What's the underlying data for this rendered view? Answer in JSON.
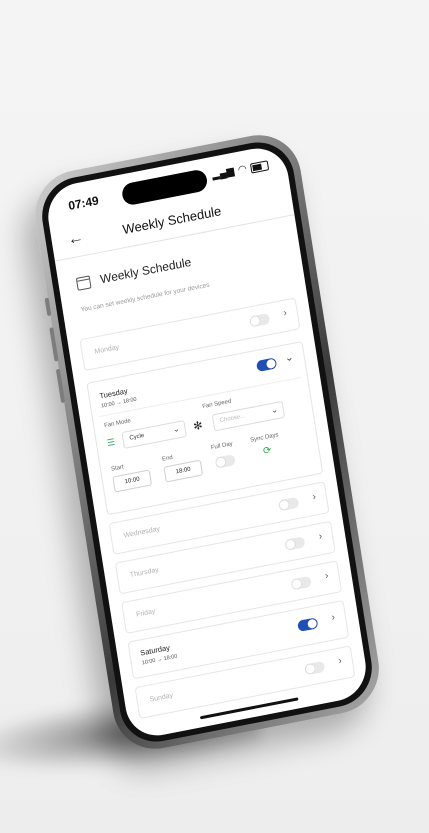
{
  "status": {
    "time": "07:49"
  },
  "nav": {
    "back": "←",
    "title": "Weekly Schedule"
  },
  "section": {
    "title": "Weekly Schedule",
    "subtitle": "You can set weekly schedule for your devices"
  },
  "days": {
    "monday": {
      "label": "Monday",
      "enabled": false
    },
    "tuesday": {
      "label": "Tuesday",
      "time_range": "10:00 → 18:00",
      "enabled": true,
      "fan_mode_label": "Fan Mode",
      "fan_mode_value": "Cycle",
      "fan_speed_label": "Fan Speed",
      "fan_speed_placeholder": "Choose...",
      "start_label": "Start",
      "start_value": "10:00",
      "end_label": "End",
      "end_value": "18:00",
      "full_day_label": "Full Day",
      "full_day_enabled": false,
      "sync_days_label": "Sync Days"
    },
    "wednesday": {
      "label": "Wednesday",
      "enabled": false
    },
    "thursday": {
      "label": "Thursday",
      "enabled": false
    },
    "friday": {
      "label": "Friday",
      "enabled": false
    },
    "saturday": {
      "label": "Saturday",
      "time_range": "10:00 → 18:00",
      "enabled": true
    },
    "sunday": {
      "label": "Sunday",
      "enabled": false
    }
  },
  "icons": {
    "chevron_right": "›",
    "chevron_down": "⌄",
    "fan": "✻",
    "sync": "⟳",
    "mode": "☰"
  },
  "colors": {
    "accent": "#1f4fb5",
    "sync_green": "#27a74a"
  }
}
